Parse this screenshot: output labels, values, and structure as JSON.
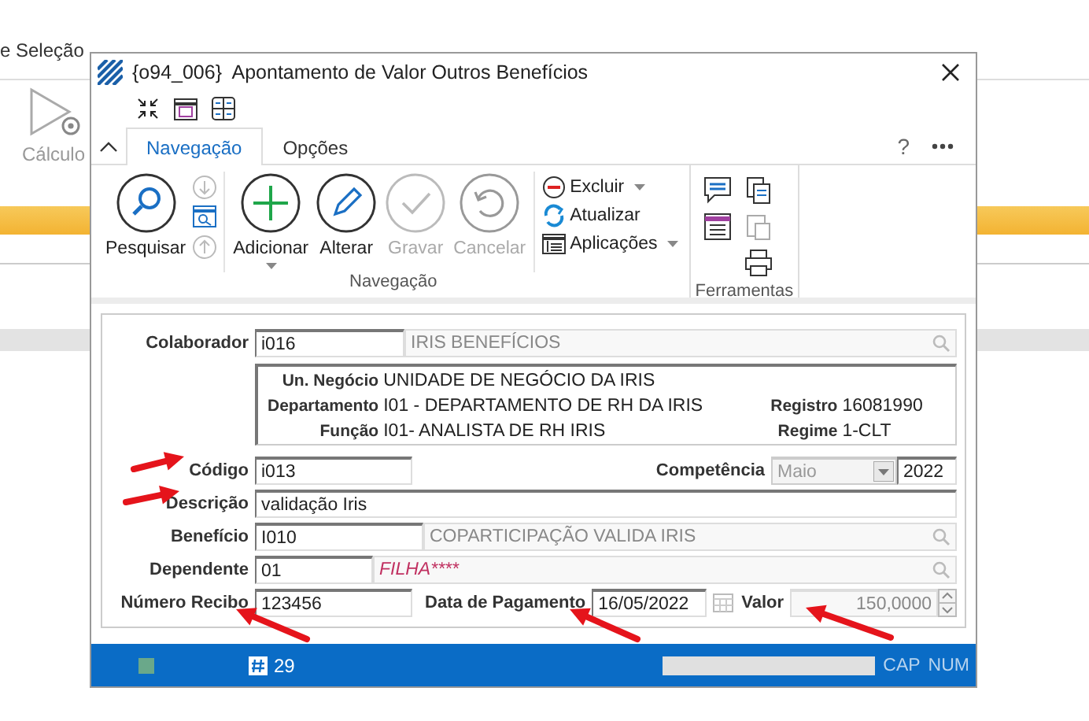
{
  "background_app": {
    "tab": "e Seleção",
    "button": "Cálculo"
  },
  "window": {
    "title": "{o94_006}  Apontamento de Valor Outros Benefícios"
  },
  "ribbon": {
    "tabs": [
      {
        "label": "Navegação",
        "selected": true
      },
      {
        "label": "Opções",
        "selected": false
      }
    ],
    "help": "?",
    "nav_small": [
      {
        "disabled": true
      },
      {
        "disabled": false
      },
      {
        "disabled": true
      }
    ],
    "nav_buttons": [
      {
        "label": "Pesquisar",
        "disabled": false,
        "has_menu": false
      },
      {
        "label": "Adicionar",
        "disabled": false,
        "has_menu": true
      },
      {
        "label": "Alterar",
        "disabled": false,
        "has_menu": false
      },
      {
        "label": "Gravar",
        "disabled": true,
        "has_menu": false
      },
      {
        "label": "Cancelar",
        "disabled": true,
        "has_menu": false
      }
    ],
    "menu_items": [
      {
        "label": "Excluir",
        "has_menu": true
      },
      {
        "label": "Atualizar",
        "has_menu": false
      },
      {
        "label": "Aplicações",
        "has_menu": true
      }
    ],
    "groups": [
      "Navegação",
      "Ferramentas"
    ]
  },
  "form": {
    "colaborador": {
      "label": "Colaborador",
      "code": "i016",
      "name": "IRIS BENEFÍCIOS"
    },
    "info": [
      {
        "label": "Un. Negócio",
        "value": "UNIDADE DE NEGÓCIO DA IRIS"
      },
      {
        "label": "Departamento",
        "value": "I01 - DEPARTAMENTO DE RH DA IRIS"
      },
      {
        "label": "Função",
        "value": "I01- ANALISTA DE RH IRIS"
      },
      {
        "label": "Registro",
        "value": "16081990"
      },
      {
        "label": "Regime",
        "value": "1-CLT"
      }
    ],
    "codigo": {
      "label": "Código",
      "value": "i013"
    },
    "competencia": {
      "label": "Competência",
      "month": "Maio",
      "year": "2022"
    },
    "descricao": {
      "label": "Descrição",
      "value": "validação Iris"
    },
    "beneficio": {
      "label": "Benefício",
      "code": "I010",
      "name": "COPARTICIPAÇÃO VALIDA IRIS"
    },
    "dependente": {
      "label": "Dependente",
      "code": "01",
      "name": "FILHA****"
    },
    "numero_recibo": {
      "label": "Número Recibo",
      "value": "123456"
    },
    "data_pagamento": {
      "label": "Data de Pagamento",
      "value": "16/05/2022"
    },
    "valor": {
      "label": "Valor",
      "value": "150,0000",
      "disabled": true
    }
  },
  "status_bar": {
    "count": "29",
    "indicators": [
      "CAP",
      "NUM"
    ]
  }
}
